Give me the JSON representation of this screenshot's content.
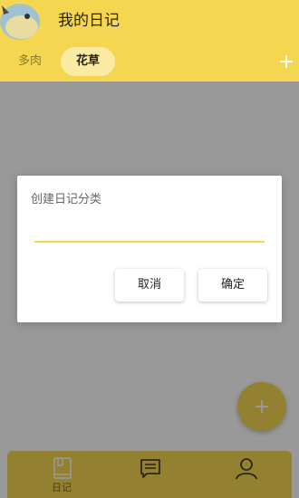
{
  "header": {
    "title": "我的日记",
    "tabs": [
      {
        "label": "多肉",
        "selected": false
      },
      {
        "label": "花草",
        "selected": true
      }
    ],
    "add_icon": "plus-icon"
  },
  "bottom_nav": {
    "items": [
      {
        "label": "日记",
        "icon": "diary-book-icon"
      },
      {
        "label": "",
        "icon": "message-icon"
      },
      {
        "label": "",
        "icon": "user-icon"
      }
    ]
  },
  "dialog": {
    "title": "创建日记分类",
    "input_value": "",
    "cancel_label": "取消",
    "confirm_label": "确定"
  },
  "colors": {
    "accent": "#f5d651",
    "overlay": "rgba(0,0,0,0.4)"
  }
}
